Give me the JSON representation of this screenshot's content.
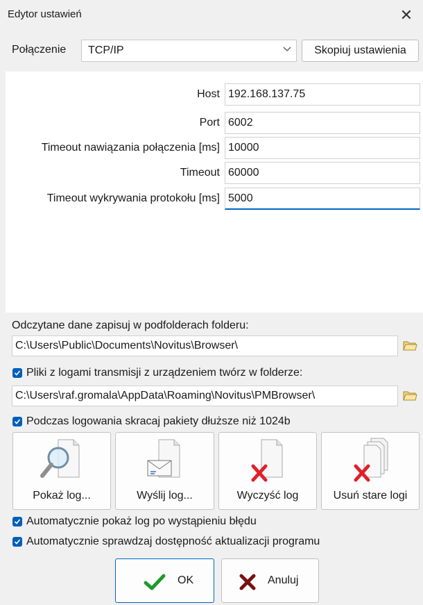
{
  "window": {
    "title": "Edytor ustawień",
    "close_glyph": "✕"
  },
  "connection": {
    "label": "Połączenie",
    "value": "TCP/IP",
    "copy_label": "Skopiuj ustawienia"
  },
  "fields": {
    "host": {
      "label": "Host",
      "value": "192.168.137.75"
    },
    "port": {
      "label": "Port",
      "value": "6002"
    },
    "conn_timeout": {
      "label": "Timeout nawiązania połączenia [ms]",
      "value": "10000"
    },
    "timeout": {
      "label": "Timeout",
      "value": "60000"
    },
    "proto_timeout": {
      "label": "Timeout wykrywania protokołu [ms]",
      "value": "5000"
    }
  },
  "data_folder": {
    "label": "Odczytane dane zapisuj w podfolderach folderu:",
    "path": "C:\\Users\\Public\\Documents\\Novitus\\Browser\\"
  },
  "log_folder": {
    "label": "Pliki z logami transmisji z urządzeniem twórz w folderze:",
    "checked": true,
    "path": "C:\\Users\\raf.gromala\\AppData\\Roaming\\Novitus\\PMBrowser\\"
  },
  "truncate": {
    "label": "Podczas logowania skracaj pakiety dłuższe niż 1024b",
    "checked": true
  },
  "log_buttons": {
    "show": "Pokaż log...",
    "send": "Wyślij log...",
    "clear": "Wyczyść log",
    "delete_old": "Usuń stare logi"
  },
  "auto_show": {
    "label": "Automatycznie pokaż log po wystąpieniu błędu",
    "checked": true
  },
  "auto_update": {
    "label": "Automatycznie sprawdzaj dostępność aktualizacji programu",
    "checked": true
  },
  "buttons": {
    "ok": "OK",
    "cancel": "Anuluj"
  },
  "colors": {
    "accent": "#005fb8",
    "ok_check": "#1e9a2c",
    "cancel_x": "#7a1010",
    "delete_x": "#e0202a"
  }
}
